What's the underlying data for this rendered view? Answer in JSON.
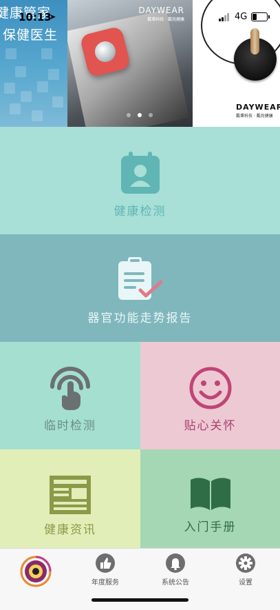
{
  "status_bar": {
    "time": "10:13",
    "network": "4G",
    "battery_level": 0.35
  },
  "banner": {
    "promo_line1": "健康管家",
    "promo_line2": "保健医生",
    "brand": "DAYWEAR",
    "brand_subtitle": "戴秉科技 · 戴尚健康",
    "active_slide": 2,
    "slide_count": 3
  },
  "menu": {
    "health_check": "健康检测",
    "organ_report": "器官功能走势报告",
    "temp_check": "临时检测",
    "care": "贴心关怀",
    "health_news": "健康资讯",
    "guide": "入门手册"
  },
  "tabbar": {
    "annual_service": "年度服务",
    "system_notice": "系统公告",
    "settings": "设置"
  },
  "colors": {
    "tile_health_check": "#a8dfd7",
    "tile_organ_report": "#7fb7bd",
    "tile_temp_check": "#a5dfd0",
    "tile_care": "#edc9d4",
    "tile_health_news": "#e2eeb8",
    "tile_guide": "#a6d7b4"
  }
}
